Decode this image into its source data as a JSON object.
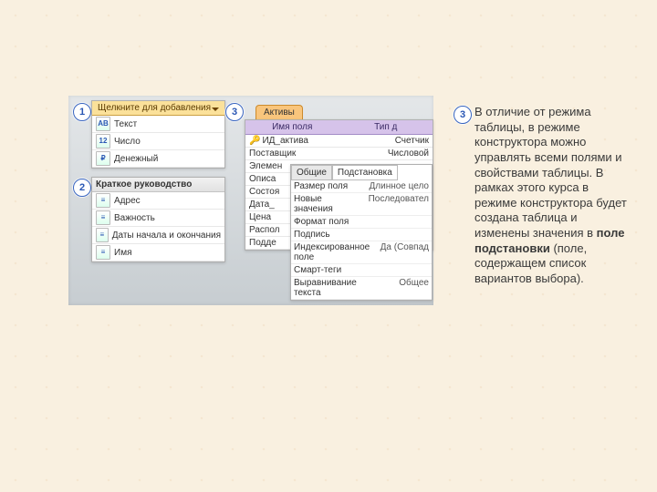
{
  "badges": {
    "b1": "1",
    "b2": "2",
    "b3": "3",
    "b3b": "3"
  },
  "panel1": {
    "header": "Щелкните для добавления",
    "items": [
      {
        "icon": "AB",
        "label": "Текст"
      },
      {
        "icon": "12",
        "label": "Число"
      },
      {
        "icon": "₽",
        "label": "Денежный"
      }
    ]
  },
  "panel2": {
    "header": "Краткое руководство",
    "items": [
      {
        "icon": "≡",
        "label": "Адрес"
      },
      {
        "icon": "≡",
        "label": "Важность"
      },
      {
        "icon": "≡",
        "label": "Даты начала и окончания"
      },
      {
        "icon": "≡",
        "label": "Имя"
      }
    ]
  },
  "panel3": {
    "tab": "Активы",
    "colField": "Имя поля",
    "colType": "Тип д",
    "rows": [
      {
        "key": true,
        "field": "ИД_актива",
        "type": "Счетчик"
      },
      {
        "field": "Поставщик",
        "type": "Числовой"
      },
      {
        "field": "Элемен",
        "type": ""
      },
      {
        "field": "Описа",
        "type": ""
      },
      {
        "field": "Состоя",
        "type": ""
      },
      {
        "field": "Дата_",
        "type": ""
      },
      {
        "field": "Цена",
        "type": ""
      },
      {
        "field": "Распол",
        "type": ""
      },
      {
        "field": "Подде",
        "type": ""
      }
    ],
    "propTabs": {
      "general": "Общие",
      "lookup": "Подстановка"
    },
    "props": [
      {
        "l": "Размер поля",
        "v": "Длинное цело"
      },
      {
        "l": "Новые значения",
        "v": "Последовател"
      },
      {
        "l": "Формат поля",
        "v": ""
      },
      {
        "l": "Подпись",
        "v": ""
      },
      {
        "l": "Индексированное поле",
        "v": "Да (Совпад"
      },
      {
        "l": "Смарт-теги",
        "v": ""
      },
      {
        "l": "Выравнивание текста",
        "v": "Общее"
      }
    ]
  },
  "para": {
    "t1": "В отличие от режима таблицы, в режиме конструктора можно управлять всеми полями и свойствами таблицы. В рамках этого курса в режиме конструктора будет создана таблица и изменены значения в",
    "bold": "поле подстановки",
    "t2": "(поле, содержащем список вариантов выбора)."
  }
}
